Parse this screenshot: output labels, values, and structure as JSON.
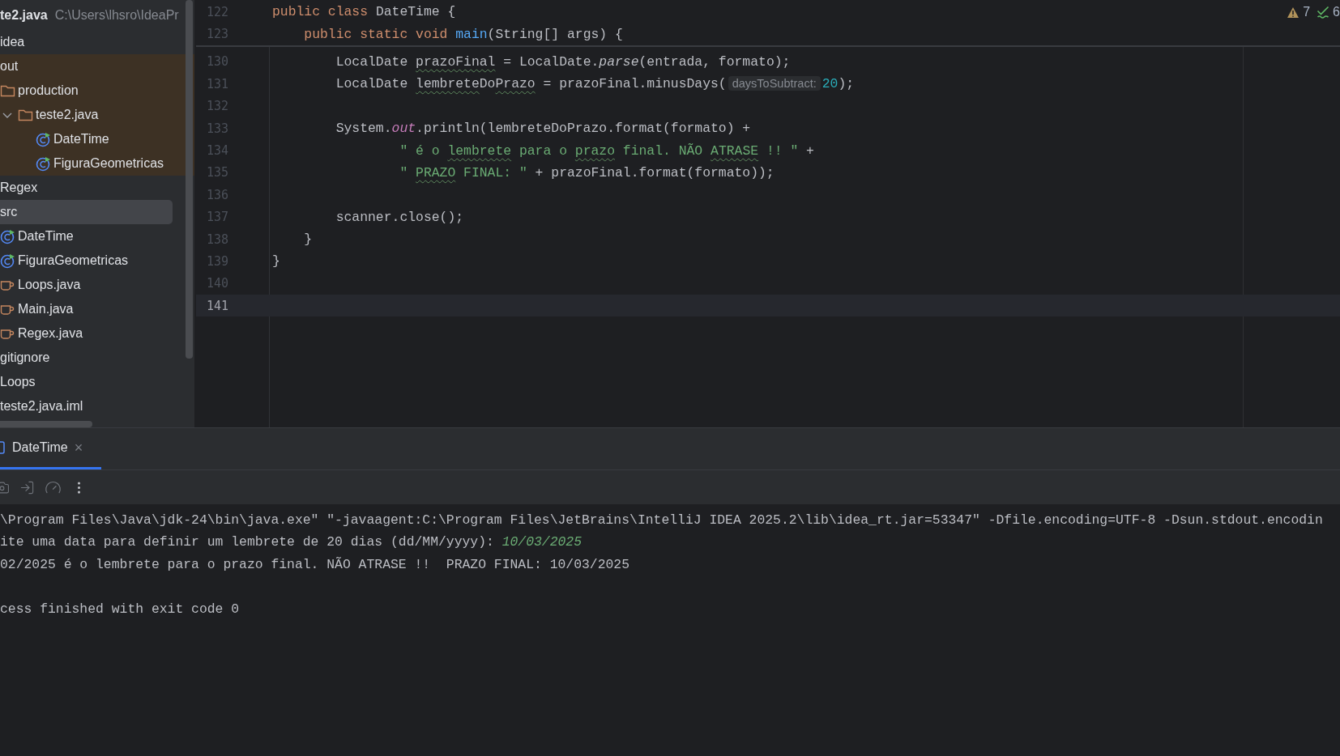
{
  "project_tree": {
    "root": {
      "name": "te2.java",
      "path": "C:\\Users\\lhsro\\IdeaPr"
    },
    "items": [
      {
        "label": "idea",
        "selected": false,
        "excluded": false
      },
      {
        "label": "out",
        "selected": false,
        "excluded": true,
        "children": [
          {
            "label": "production",
            "kind": "folder",
            "selected": false,
            "children": [
              {
                "label": "teste2.java",
                "kind": "folder",
                "expanded": true,
                "selected": false,
                "children": [
                  {
                    "label": "DateTime",
                    "kind": "class",
                    "selected": false
                  },
                  {
                    "label": "FiguraGeometricas",
                    "kind": "class",
                    "selected": false
                  }
                ]
              }
            ]
          }
        ]
      },
      {
        "label": "Regex",
        "selected": false,
        "excluded": false
      },
      {
        "label": "src",
        "selected": true,
        "excluded": false,
        "children": [
          {
            "label": "DateTime",
            "kind": "class",
            "selected": false
          },
          {
            "label": "FiguraGeometricas",
            "kind": "class",
            "selected": false
          },
          {
            "label": "Loops.java",
            "kind": "java",
            "selected": false
          },
          {
            "label": "Main.java",
            "kind": "java",
            "selected": false
          },
          {
            "label": "Regex.java",
            "kind": "java",
            "selected": false
          }
        ]
      },
      {
        "label": "gitignore",
        "selected": false,
        "excluded": false
      },
      {
        "label": "Loops",
        "selected": false,
        "excluded": false
      },
      {
        "label": "teste2.java.iml",
        "selected": false,
        "excluded": false
      }
    ]
  },
  "editor": {
    "inspections": [
      {
        "kind": "warning",
        "count": "7"
      },
      {
        "kind": "ok",
        "count": "6"
      }
    ],
    "sticky_lines": [
      {
        "number": "122",
        "tokens": [
          {
            "kind": "kw",
            "text": "public class ",
            "typo": false
          },
          {
            "kind": "plain",
            "text": "DateTime {",
            "typo": false
          }
        ]
      },
      {
        "number": "123",
        "tokens": [
          {
            "kind": "kw",
            "text": "    public static void ",
            "typo": false
          },
          {
            "kind": "fn",
            "text": "main",
            "typo": false
          },
          {
            "kind": "plain",
            "text": "(String[] args) {",
            "typo": false
          }
        ]
      }
    ],
    "lines": [
      {
        "number": "130",
        "current": false,
        "tokens": [
          {
            "kind": "plain",
            "text": "        LocalDate ",
            "typo": false
          },
          {
            "kind": "plain",
            "text": "prazoFinal",
            "typo": true
          },
          {
            "kind": "plain",
            "text": " = LocalDate.",
            "typo": false
          },
          {
            "kind": "italic",
            "text": "parse",
            "typo": false
          },
          {
            "kind": "plain",
            "text": "(entrada, formato);",
            "typo": false
          }
        ]
      },
      {
        "number": "131",
        "current": false,
        "tokens": [
          {
            "kind": "plain",
            "text": "        LocalDate ",
            "typo": false
          },
          {
            "kind": "plain",
            "text": "lembrete",
            "typo": true
          },
          {
            "kind": "plain",
            "text": "Do",
            "typo": false
          },
          {
            "kind": "plain",
            "text": "Prazo",
            "typo": true
          },
          {
            "kind": "plain",
            "text": " = prazoFinal.minusDays(",
            "typo": false
          },
          {
            "kind": "hint",
            "text": "daysToSubtract:",
            "typo": false
          },
          {
            "kind": "num",
            "text": "20",
            "typo": false
          },
          {
            "kind": "plain",
            "text": ");",
            "typo": false
          }
        ]
      },
      {
        "number": "132",
        "current": false
      },
      {
        "number": "133",
        "current": false,
        "tokens": [
          {
            "kind": "plain",
            "text": "        System.",
            "typo": false
          },
          {
            "kind": "field",
            "text": "out",
            "typo": false
          },
          {
            "kind": "plain",
            "text": ".println(lembreteDoPrazo.format(formato) +",
            "typo": false
          }
        ]
      },
      {
        "number": "134",
        "current": false,
        "tokens": [
          {
            "kind": "str",
            "text": "                \" é o ",
            "typo": false
          },
          {
            "kind": "str",
            "text": "lembrete",
            "typo": true
          },
          {
            "kind": "str",
            "text": " para o ",
            "typo": false
          },
          {
            "kind": "str",
            "text": "prazo",
            "typo": true
          },
          {
            "kind": "str",
            "text": " final. NÃO ",
            "typo": false
          },
          {
            "kind": "str",
            "text": "ATRASE",
            "typo": true
          },
          {
            "kind": "str",
            "text": " !! \"",
            "typo": false
          },
          {
            "kind": "plain",
            "text": " +",
            "typo": false
          }
        ]
      },
      {
        "number": "135",
        "current": false,
        "tokens": [
          {
            "kind": "str",
            "text": "                \" ",
            "typo": false
          },
          {
            "kind": "str",
            "text": "PRAZO",
            "typo": true
          },
          {
            "kind": "str",
            "text": " FINAL: \"",
            "typo": false
          },
          {
            "kind": "plain",
            "text": " + prazoFinal.format(formato));",
            "typo": false
          }
        ]
      },
      {
        "number": "136",
        "current": false
      },
      {
        "number": "137",
        "current": false,
        "tokens": [
          {
            "kind": "plain",
            "text": "        scanner.close();",
            "typo": false
          }
        ]
      },
      {
        "number": "138",
        "current": false,
        "tokens": [
          {
            "kind": "plain",
            "text": "    }",
            "typo": false
          }
        ]
      },
      {
        "number": "139",
        "current": false,
        "tokens": [
          {
            "kind": "plain",
            "text": "}",
            "typo": false
          }
        ]
      },
      {
        "number": "140",
        "current": false
      },
      {
        "number": "141",
        "current": true
      }
    ]
  },
  "run_panel": {
    "tabs": [
      {
        "label": "DateTime",
        "selected": true,
        "close": "×"
      }
    ],
    "toolbar": [
      {
        "kind": "camera"
      },
      {
        "kind": "login"
      },
      {
        "kind": "gauge"
      },
      {
        "kind": "more"
      }
    ],
    "console": [
      {
        "kind": "text",
        "segments": [
          {
            "kind": "output",
            "text": "\\Program Files\\Java\\jdk-24\\bin\\java.exe\" \"-javaagent:C:\\Program Files\\JetBrains\\IntelliJ IDEA 2025.2\\lib\\idea_rt.jar=53347\" -Dfile.encoding=UTF-8 -Dsun.stdout.encodin"
          }
        ]
      },
      {
        "kind": "text",
        "segments": [
          {
            "kind": "output",
            "text": "ite uma data para definir um lembrete de 20 dias (dd/MM/yyyy): "
          },
          {
            "kind": "input",
            "text": "10/03/2025"
          }
        ]
      },
      {
        "kind": "text",
        "segments": [
          {
            "kind": "output",
            "text": "02/2025 é o lembrete para o prazo final. NÃO ATRASE !!  PRAZO FINAL: 10/03/2025"
          }
        ]
      },
      {
        "kind": "blank"
      },
      {
        "kind": "text",
        "segments": [
          {
            "kind": "output",
            "text": "cess finished with exit code 0"
          }
        ]
      }
    ]
  }
}
